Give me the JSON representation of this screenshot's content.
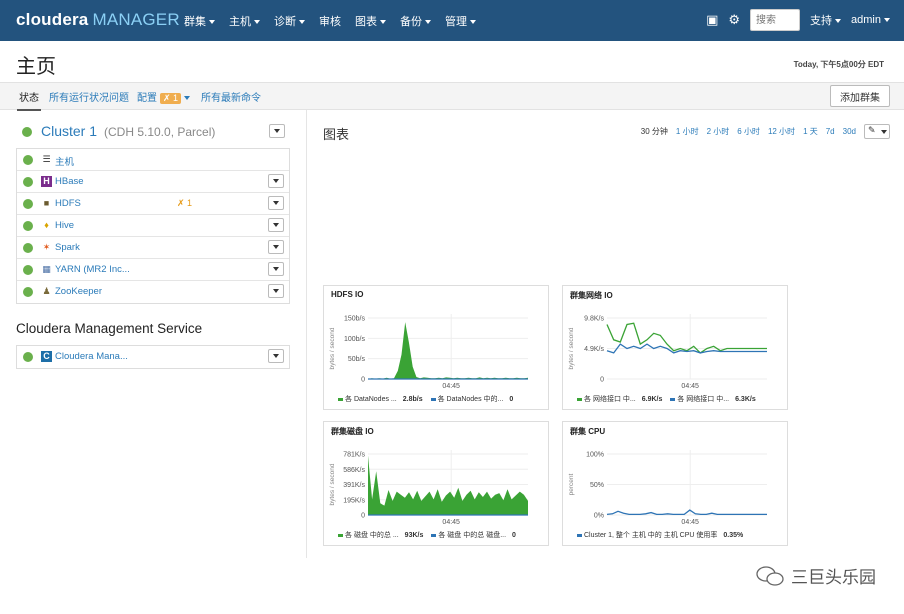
{
  "header": {
    "logo_main": "cloudera",
    "logo_sub": "MANAGER",
    "nav": [
      "群集",
      "主机",
      "诊断",
      "审核",
      "图表",
      "备份",
      "管理"
    ],
    "nav_has_caret": [
      true,
      true,
      true,
      false,
      true,
      true,
      true
    ],
    "search_placeholder": "搜索",
    "support": "支持",
    "user": "admin"
  },
  "page": {
    "title": "主页",
    "timestamp": "Today, 下午5点00分 EDT"
  },
  "tabs": {
    "status": "状态",
    "health_issues": "所有运行状况问题",
    "config": "配置",
    "config_badge": "1",
    "recent_commands": "所有最新命令",
    "add_cluster": "添加群集"
  },
  "cluster": {
    "name": "Cluster 1",
    "version": "(CDH 5.10.0, Parcel)",
    "services": [
      {
        "name": "主机",
        "icon": "list-icon",
        "dropdown": false,
        "warn": ""
      },
      {
        "name": "HBase",
        "icon": "hbase-icon",
        "dropdown": true,
        "warn": ""
      },
      {
        "name": "HDFS",
        "icon": "hdfs-icon",
        "dropdown": true,
        "warn": "1"
      },
      {
        "name": "Hive",
        "icon": "hive-icon",
        "dropdown": true,
        "warn": ""
      },
      {
        "name": "Spark",
        "icon": "spark-icon",
        "dropdown": true,
        "warn": ""
      },
      {
        "name": "YARN (MR2 Inc...",
        "icon": "yarn-icon",
        "dropdown": true,
        "warn": ""
      },
      {
        "name": "ZooKeeper",
        "icon": "zookeeper-icon",
        "dropdown": true,
        "warn": ""
      }
    ]
  },
  "mgmt": {
    "title": "Cloudera Management Service",
    "service": "Cloudera Mana..."
  },
  "charts_panel": {
    "title": "图表",
    "ranges": [
      "30 分钟",
      "1 小时",
      "2 小时",
      "6 小时",
      "12 小时",
      "1 天",
      "7d",
      "30d"
    ]
  },
  "colors": {
    "nav_bg": "#23537e",
    "link": "#2b7bb9",
    "status_green": "#6ab04c",
    "series_green": "#3aa335",
    "series_blue": "#2e74b5"
  },
  "chart_data": [
    {
      "type": "area",
      "title": "HDFS IO",
      "ylabel": "bytes / second",
      "yticks": [
        "150b/s",
        "100b/s",
        "50b/s",
        "0"
      ],
      "ylim": [
        0,
        150
      ],
      "xtick": "04:45",
      "series": [
        {
          "name": "各 DataNodes ...",
          "value": "2.8b/s",
          "color": "green",
          "values": [
            0,
            2,
            1,
            2,
            1,
            3,
            1,
            2,
            20,
            60,
            140,
            90,
            30,
            5,
            2,
            4,
            3,
            2,
            2,
            3,
            2,
            4,
            3,
            2,
            3,
            2,
            2,
            3,
            2,
            2,
            4,
            2,
            3,
            2,
            3,
            2,
            2,
            3,
            2,
            2,
            3,
            2,
            2,
            3
          ]
        },
        {
          "name": "各 DataNodes 中的...",
          "value": "0",
          "color": "blue",
          "values": [
            0,
            0,
            0,
            0,
            0,
            0,
            0,
            0,
            0,
            0,
            0,
            0,
            0,
            0,
            0,
            0,
            0,
            0,
            0,
            0,
            0,
            0,
            0,
            0,
            0,
            0,
            0,
            0,
            0,
            0,
            0,
            0,
            0,
            0,
            0,
            0,
            0,
            0,
            0,
            0,
            0,
            0,
            0,
            0
          ]
        }
      ]
    },
    {
      "type": "line",
      "title": "群集网络 IO",
      "ylabel": "bytes / second",
      "yticks": [
        "9.8K/s",
        "4.9K/s",
        "0"
      ],
      "ylim": [
        0,
        14
      ],
      "xtick": "04:45",
      "series": [
        {
          "name": "各 网络接口 中...",
          "value": "6.9K/s",
          "color": "green",
          "values": [
            12.5,
            9,
            8.5,
            12.5,
            12.8,
            8,
            9,
            10.5,
            10,
            8,
            6.5,
            7,
            6.5,
            7.5,
            6,
            7,
            7.5,
            6.5,
            7,
            7,
            7,
            7,
            7,
            7,
            7
          ]
        },
        {
          "name": "各 网络接口 中...",
          "value": "6.3K/s",
          "color": "blue",
          "values": [
            6.5,
            6,
            8,
            7,
            7.5,
            7,
            8,
            7,
            7.5,
            7,
            6,
            6.5,
            6.3,
            6.5,
            6,
            6.3,
            6.5,
            6.3,
            6.3,
            6.3,
            6.3,
            6.3,
            6.3,
            6.3,
            6.3
          ]
        }
      ]
    },
    {
      "type": "area",
      "title": "群集磁盘 IO",
      "ylabel": "bytes / second",
      "yticks": [
        "781K/s",
        "586K/s",
        "391K/s",
        "195K/s",
        "0"
      ],
      "ylim": [
        0,
        781
      ],
      "xtick": "04:45",
      "series": [
        {
          "name": "各 磁盘 中的总 ...",
          "value": "93K/s",
          "color": "green",
          "values": [
            760,
            200,
            560,
            150,
            120,
            320,
            180,
            300,
            260,
            220,
            290,
            200,
            310,
            180,
            240,
            300,
            200,
            330,
            170,
            250,
            300,
            220,
            350,
            180,
            260,
            310,
            200,
            290,
            230,
            300,
            210,
            260,
            280,
            190,
            330,
            200,
            250,
            300,
            260,
            180
          ]
        },
        {
          "name": "各 磁盘 中的总 磁盘...",
          "value": "0",
          "color": "blue",
          "values": [
            0,
            0,
            0,
            0,
            0,
            0,
            0,
            0,
            0,
            0,
            0,
            0,
            0,
            0,
            0,
            0,
            0,
            0,
            0,
            0,
            0,
            0,
            0,
            0,
            0,
            0,
            0,
            0,
            0,
            0,
            0,
            0,
            0,
            0,
            0,
            0,
            0,
            0,
            0,
            0
          ]
        }
      ]
    },
    {
      "type": "line",
      "title": "群集 CPU",
      "ylabel": "percent",
      "yticks": [
        "100%",
        "50%",
        "0%"
      ],
      "ylim": [
        0,
        100
      ],
      "xtick": "04:45",
      "series": [
        {
          "name": "Cluster 1, 整个 主机 中的 主机 CPU 使用率",
          "value": "0.35%",
          "color": "blue",
          "values": [
            1,
            2,
            6,
            3,
            1,
            1,
            1,
            2,
            4,
            1,
            1,
            2,
            1,
            1,
            1,
            8,
            2,
            1,
            1,
            3,
            1,
            1,
            1,
            1,
            1,
            1,
            1,
            1,
            1,
            1
          ]
        }
      ]
    }
  ],
  "watermark": "三巨头乐园"
}
